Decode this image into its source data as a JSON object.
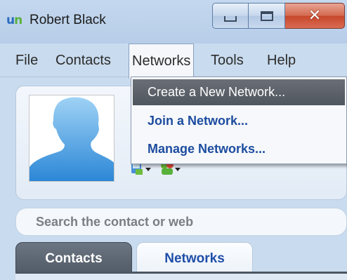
{
  "window": {
    "logo_text": "un",
    "title": "Robert Black"
  },
  "menubar": {
    "items": [
      "File",
      "Contacts",
      "Networks",
      "Tools",
      "Help"
    ],
    "open_menu": "Networks"
  },
  "networks_menu": {
    "items": [
      "Create a New Network...",
      "Join a Network...",
      "Manage Networks..."
    ],
    "highlighted_index": 0
  },
  "search": {
    "placeholder": "Search the contact or web"
  },
  "tabs": {
    "contacts": "Contacts",
    "networks": "Networks",
    "active": "Contacts"
  },
  "colors": {
    "window_bg": "#c9dbee",
    "close_button": "#c7472b",
    "menu_highlight": "#50565e",
    "link_blue": "#1d4c9f",
    "logo_blue": "#2a6bbf",
    "logo_green": "#58b13a"
  },
  "icons": {
    "app_logo": "un-logo",
    "minimize": "minimize-icon",
    "maximize": "maximize-icon",
    "close": "close-icon",
    "avatar": "person-silhouette",
    "status_1": "phone-status-icon",
    "status_2": "people-status-icon"
  }
}
